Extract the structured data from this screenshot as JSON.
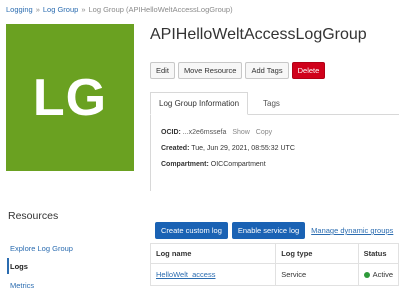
{
  "breadcrumb": {
    "root": "Logging",
    "parent": "Log Group",
    "current": "Log Group (APIHelloWeltAccessLogGroup)"
  },
  "tile": {
    "letters": "LG",
    "color": "#6aa121"
  },
  "title": "APIHelloWeltAccessLogGroup",
  "actions": {
    "edit": "Edit",
    "move": "Move Resource",
    "add_tags": "Add Tags",
    "delete": "Delete"
  },
  "tabs": {
    "info": "Log Group Information",
    "tags": "Tags"
  },
  "info": {
    "ocid_label": "OCID:",
    "ocid_value": "...x2e6mssefa",
    "show": "Show",
    "copy": "Copy",
    "created_label": "Created:",
    "created_value": "Tue, Jun 29, 2021, 08:55:32 UTC",
    "compartment_label": "Compartment:",
    "compartment_value": "OICCompartment"
  },
  "resources": {
    "title": "Resources",
    "items": [
      "Explore Log Group",
      "Logs",
      "Metrics"
    ]
  },
  "log_actions": {
    "create": "Create custom log",
    "enable": "Enable service log",
    "manage": "Manage dynamic groups"
  },
  "table": {
    "headers": [
      "Log name",
      "Log type",
      "Status"
    ],
    "rows": [
      {
        "name": "HelloWelt_access",
        "type": "Service",
        "status": "Active",
        "status_color": "#2e9a3a"
      }
    ]
  }
}
